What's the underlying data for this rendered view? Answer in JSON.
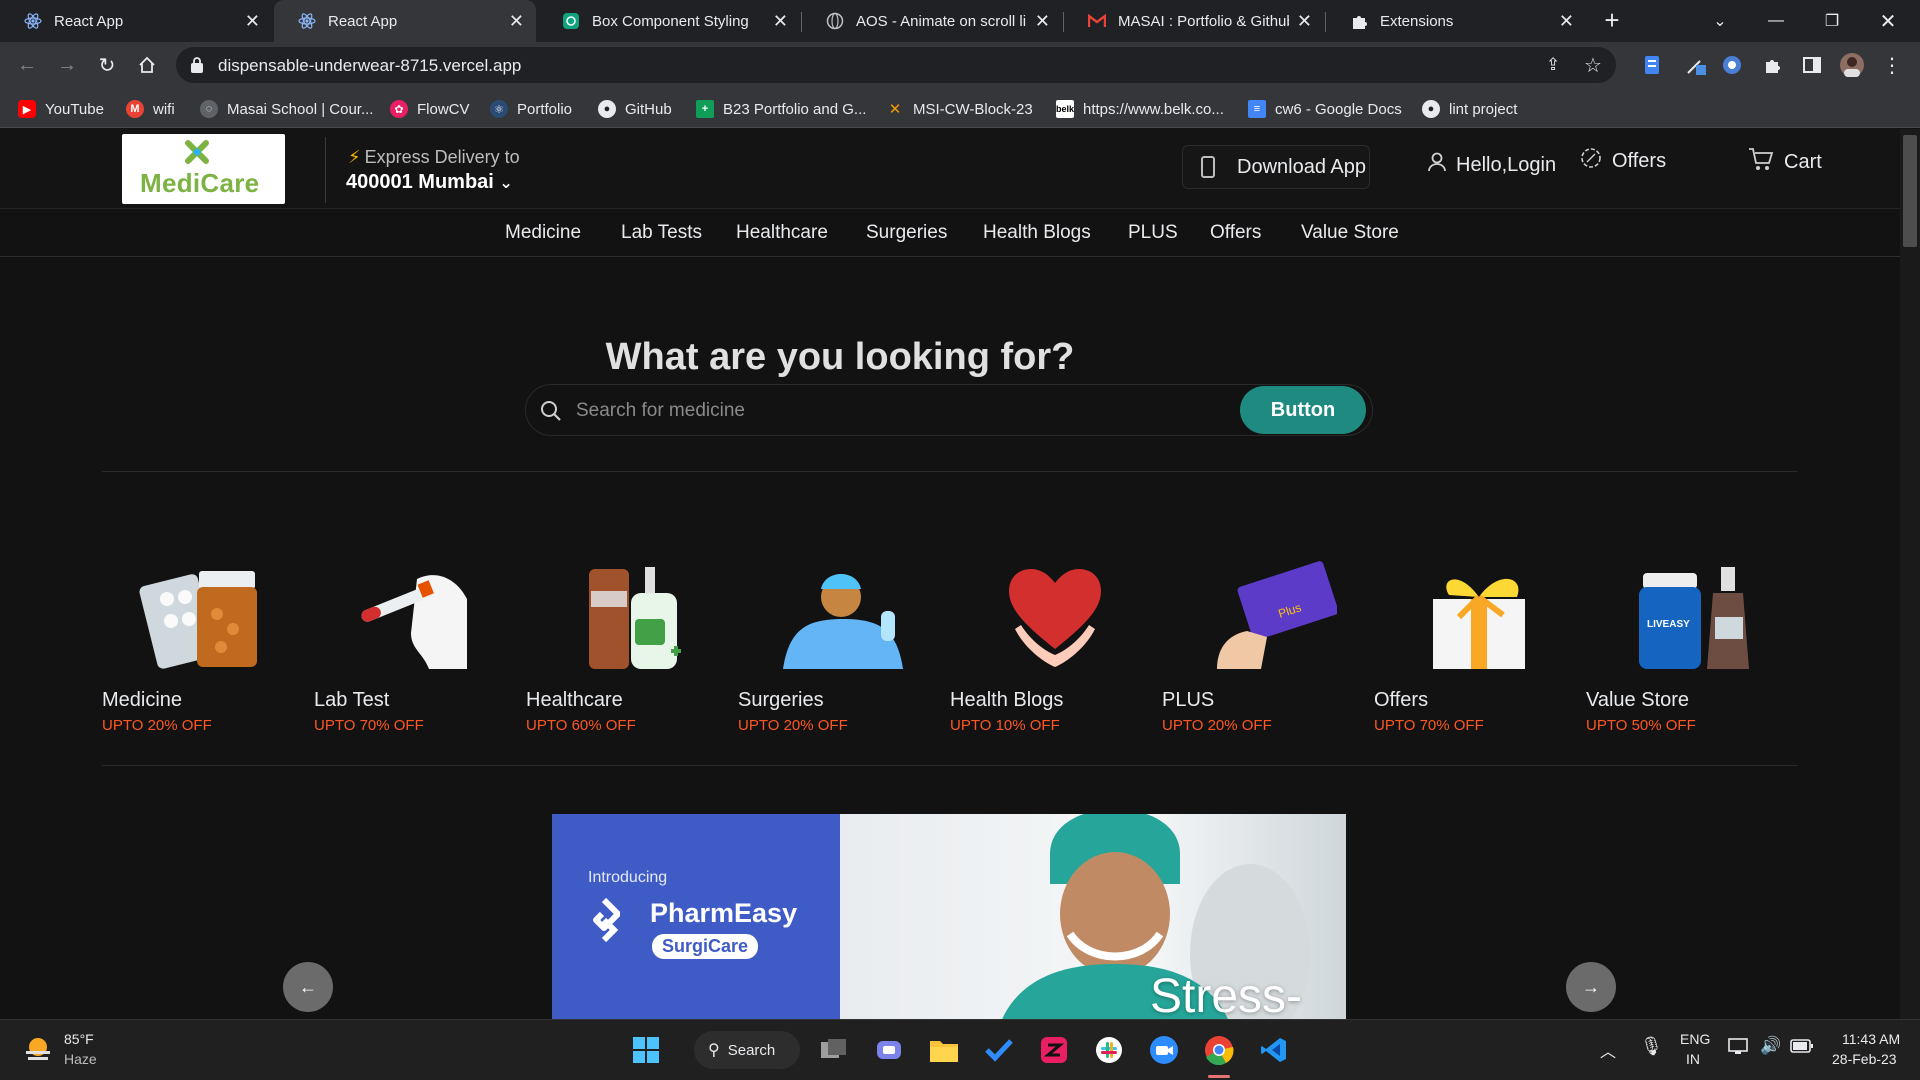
{
  "browser": {
    "tabs": [
      {
        "title": "React App",
        "icon": "react-icon",
        "active": false
      },
      {
        "title": "React App",
        "icon": "react-icon",
        "active": true
      },
      {
        "title": "Box Component Styling",
        "icon": "chatgpt-icon",
        "active": false
      },
      {
        "title": "AOS - Animate on scroll libr",
        "icon": "globe-icon",
        "active": false
      },
      {
        "title": "MASAI : Portfolio & Github",
        "icon": "gmail-icon",
        "active": false
      },
      {
        "title": "Extensions",
        "icon": "puzzle-icon",
        "active": false
      }
    ],
    "url": "dispensable-underwear-8715.vercel.app",
    "bookmarks": [
      {
        "label": "YouTube",
        "color": "#ff0000"
      },
      {
        "label": "wifi",
        "color": "#ea4335"
      },
      {
        "label": "Masai School | Cour...",
        "color": "#9aa0a6"
      },
      {
        "label": "FlowCV",
        "color": "#e91e63"
      },
      {
        "label": "Portfolio",
        "color": "#4e88c7"
      },
      {
        "label": "GitHub",
        "color": "#e8eaed"
      },
      {
        "label": "B23 Portfolio and G...",
        "color": "#0f9d58"
      },
      {
        "label": "MSI-CW-Block-23",
        "color": "#f29900"
      },
      {
        "label": "https://www.belk.co...",
        "color": "#ffffff"
      },
      {
        "label": "cw6 - Google Docs",
        "color": "#4285f4"
      },
      {
        "label": "lint project",
        "color": "#e8eaed"
      }
    ]
  },
  "header": {
    "logo_text": "MediCare",
    "express_label": "Express Delivery to",
    "location": "400001 Mumbai",
    "download_app": "Download App",
    "login": "Hello,Login",
    "offers": "Offers",
    "cart": "Cart"
  },
  "nav": [
    "Medicine",
    "Lab Tests",
    "Healthcare",
    "Surgeries",
    "Health Blogs",
    "PLUS",
    "Offers",
    "Value Store"
  ],
  "hero": {
    "heading": "What are you looking for?",
    "search_placeholder": "Search for medicine",
    "search_button": "Button"
  },
  "categories": [
    {
      "name": "Medicine",
      "offer": "UPTO 20% OFF"
    },
    {
      "name": "Lab Test",
      "offer": "UPTO 70% OFF"
    },
    {
      "name": "Healthcare",
      "offer": "UPTO 60% OFF"
    },
    {
      "name": "Surgeries",
      "offer": "UPTO 20% OFF"
    },
    {
      "name": "Health Blogs",
      "offer": "UPTO 10% OFF"
    },
    {
      "name": "PLUS",
      "offer": "UPTO 20% OFF"
    },
    {
      "name": "Offers",
      "offer": "UPTO 70% OFF"
    },
    {
      "name": "Value Store",
      "offer": "UPTO 50% OFF"
    }
  ],
  "banner": {
    "intro": "Introducing",
    "brand": "PharmEasy",
    "sub": "SurgiCare",
    "headline": "Stress-free",
    "plus_card": "Plus",
    "jar_label": "LIVEASY"
  },
  "taskbar": {
    "weather_temp": "85°F",
    "weather_desc": "Haze",
    "search_label": "Search",
    "lang": "ENG",
    "region": "IN",
    "time": "11:43 AM",
    "date": "28-Feb-23"
  },
  "colors": {
    "accent": "#1e8a80",
    "offer": "#ff5722",
    "logo_green": "#7cb342"
  }
}
